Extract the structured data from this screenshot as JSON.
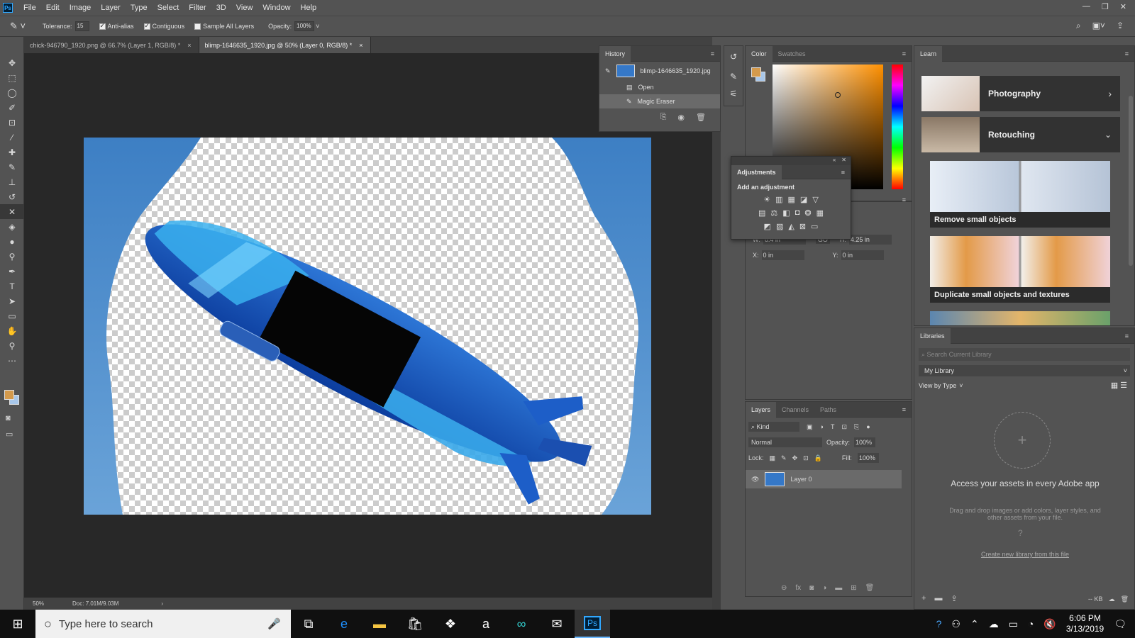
{
  "app": {
    "logo": "Ps"
  },
  "menu": [
    "File",
    "Edit",
    "Image",
    "Layer",
    "Type",
    "Select",
    "Filter",
    "3D",
    "View",
    "Window",
    "Help"
  ],
  "window_controls": {
    "minimize": "—",
    "restore": "❐",
    "close": "✕"
  },
  "options": {
    "tolerance_label": "Tolerance:",
    "tolerance_value": "15",
    "antialias_label": "Anti-alias",
    "antialias_checked": true,
    "contiguous_label": "Contiguous",
    "contiguous_checked": true,
    "sample_all_label": "Sample All Layers",
    "sample_all_checked": false,
    "opacity_label": "Opacity:",
    "opacity_value": "100%"
  },
  "tabs": [
    {
      "label": "chick-946790_1920.png @ 66.7% (Layer 1, RGB/8) *",
      "close": "×"
    },
    {
      "label": "blimp-1646635_1920.jpg @ 50% (Layer 0, RGB/8) *",
      "close": "×"
    }
  ],
  "status": {
    "zoom": "50%",
    "doc": "Doc: 7.01M/9.03M"
  },
  "history": {
    "title": "History",
    "snapshot": "blimp-1646635_1920.jpg",
    "items": [
      "Open",
      "Magic Eraser"
    ]
  },
  "color": {
    "tab_color": "Color",
    "tab_swatches": "Swatches",
    "foreground": "#d49a4c",
    "background": "#a8c7ea"
  },
  "adjustments": {
    "title": "Adjustments",
    "subtitle": "Add an adjustment"
  },
  "properties": {
    "w_label": "W:",
    "w_value": "6.4 in",
    "h_label": "H:",
    "h_value": "4.25 in",
    "x_label": "X:",
    "x_value": "0 in",
    "y_label": "Y:",
    "y_value": "0 in",
    "link": "GO"
  },
  "layers": {
    "tabs": [
      "Layers",
      "Channels",
      "Paths"
    ],
    "filter": "Kind",
    "blend": "Normal",
    "opacity_label": "Opacity:",
    "opacity_value": "100%",
    "lock_label": "Lock:",
    "fill_label": "Fill:",
    "fill_value": "100%",
    "layer_name": "Layer 0"
  },
  "learn": {
    "title": "Learn",
    "cards": [
      {
        "title": "Photography"
      },
      {
        "title": "Retouching"
      }
    ],
    "tutorials": [
      "Remove small objects",
      "Duplicate small objects and textures"
    ]
  },
  "libraries": {
    "title": "Libraries",
    "search_placeholder": "Search Current Library",
    "library": "My Library",
    "view_by": "View by Type",
    "headline": "Access your assets in every Adobe app",
    "description": "Drag and drop images or add colors, layer styles, and other assets from your file.",
    "create_link": "Create new library from this file",
    "size": "-- KB"
  },
  "taskbar": {
    "search_placeholder": "Type here to search",
    "time": "6:06 PM",
    "date": "3/13/2019",
    "ps_label": "Ps"
  }
}
